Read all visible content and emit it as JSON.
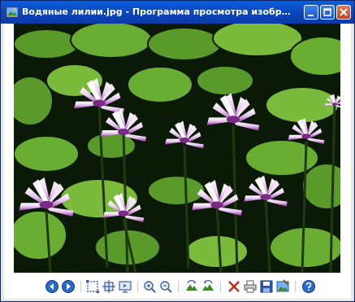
{
  "window": {
    "title": "Водяные лилии.jpg - Программа просмотра изобразени...",
    "icons": {
      "app": "image-viewer-icon",
      "minimize": "minimize-icon",
      "maximize": "maximize-icon",
      "close": "close-icon"
    },
    "colors": {
      "titlebar": "#0a4ac8",
      "close": "#d4532a"
    }
  },
  "image": {
    "name": "Водяные лилии.jpg"
  },
  "toolbar": {
    "buttons": [
      "previous-icon",
      "next-icon",
      "best-fit-icon",
      "actual-size-icon",
      "slideshow-icon",
      "zoom-in-icon",
      "zoom-out-icon",
      "rotate-clockwise-icon",
      "rotate-counterclockwise-icon",
      "delete-icon",
      "print-icon",
      "save-icon",
      "open-in-editor-icon",
      "help-icon"
    ]
  }
}
